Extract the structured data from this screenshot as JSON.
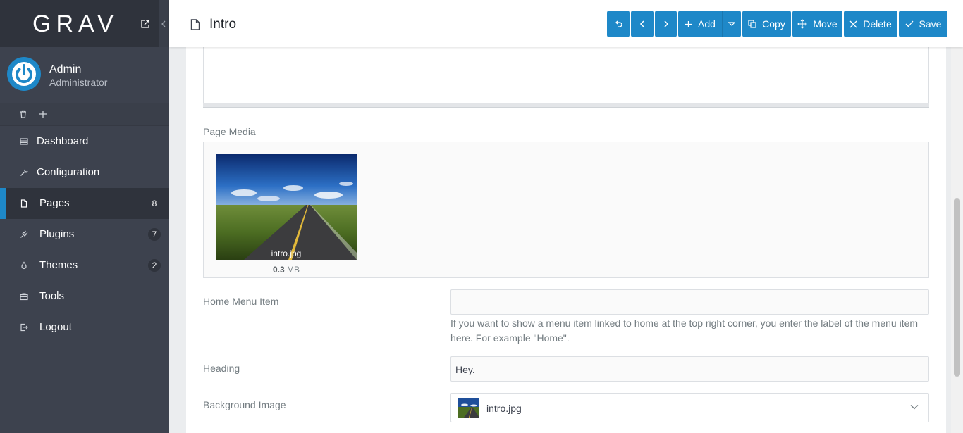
{
  "brand": {
    "logo_text": "GRAV"
  },
  "user": {
    "name": "Admin",
    "role": "Administrator"
  },
  "nav": {
    "items": [
      {
        "label": "Dashboard",
        "icon": "dashboard-icon",
        "badge": ""
      },
      {
        "label": "Configuration",
        "icon": "wrench-icon",
        "badge": ""
      },
      {
        "label": "Pages",
        "icon": "file-icon",
        "badge": "8"
      },
      {
        "label": "Plugins",
        "icon": "plug-icon",
        "badge": "7"
      },
      {
        "label": "Themes",
        "icon": "tint-icon",
        "badge": "2"
      },
      {
        "label": "Tools",
        "icon": "briefcase-icon",
        "badge": ""
      },
      {
        "label": "Logout",
        "icon": "sign-out-icon",
        "badge": ""
      }
    ]
  },
  "header": {
    "title": "Intro",
    "buttons": {
      "add": "Add",
      "copy": "Copy",
      "move": "Move",
      "delete": "Delete",
      "save": "Save"
    }
  },
  "media": {
    "section_label": "Page Media",
    "file_name": "intro.jpg",
    "file_size_value": "0.3",
    "file_size_unit": "MB"
  },
  "form": {
    "home_menu_item": {
      "label": "Home Menu Item",
      "value": "",
      "help": "If you want to show a menu item linked to home at the top right corner, you enter the label of the menu item here. For example \"Home\"."
    },
    "heading": {
      "label": "Heading",
      "value": "Hey."
    },
    "background_image": {
      "label": "Background Image",
      "value": "intro.jpg"
    }
  },
  "colors": {
    "accent": "#1e88c8",
    "sidebar": "#3d424e",
    "sidebar_dark": "#2f333c"
  }
}
